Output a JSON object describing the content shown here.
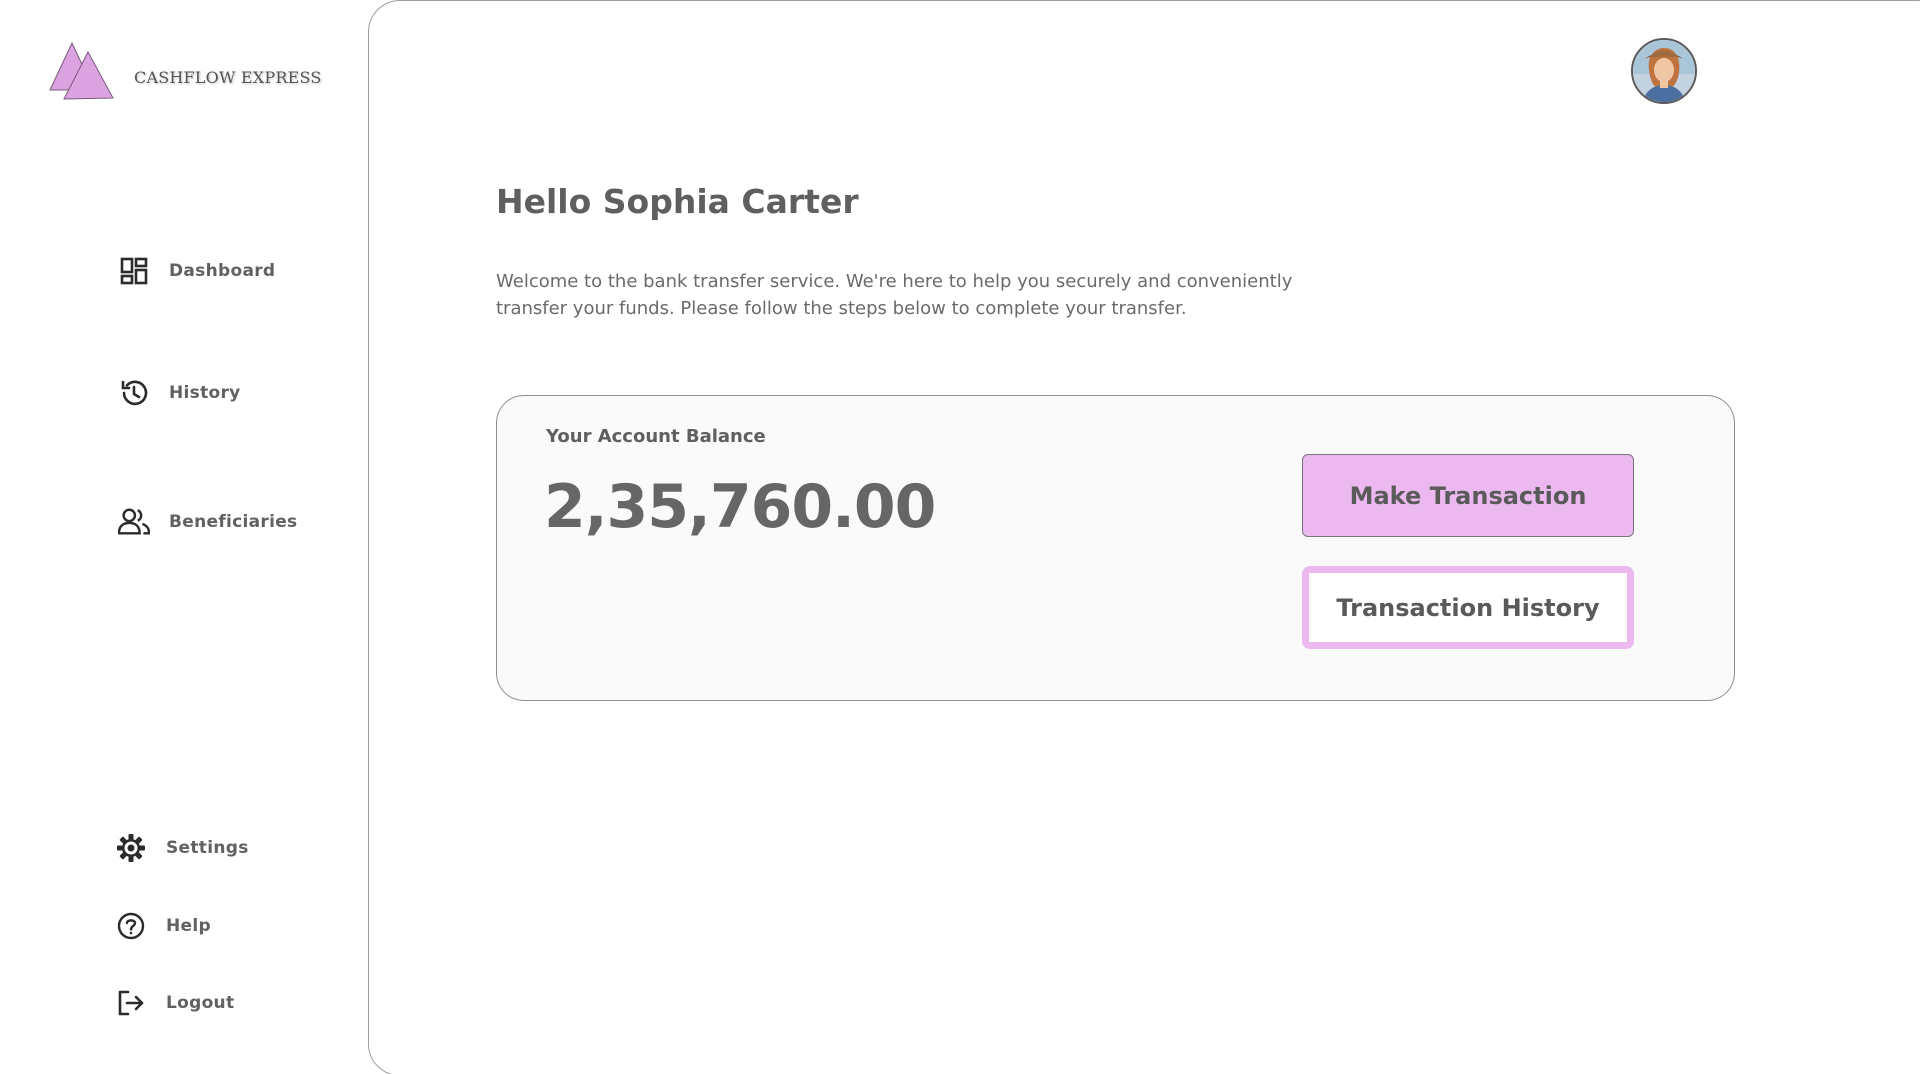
{
  "brand": {
    "name": "CASHFLOW EXPRESS",
    "logo_color": "#dba4e0"
  },
  "sidebar": {
    "nav": [
      {
        "label": "Dashboard",
        "icon": "dashboard-icon"
      },
      {
        "label": "History",
        "icon": "history-icon"
      },
      {
        "label": "Beneficiaries",
        "icon": "people-icon"
      }
    ],
    "bottom": [
      {
        "label": "Settings",
        "icon": "gear-icon"
      },
      {
        "label": "Help",
        "icon": "help-icon"
      },
      {
        "label": "Logout",
        "icon": "logout-icon"
      }
    ]
  },
  "header": {
    "avatar": "user-avatar"
  },
  "main": {
    "greeting": "Hello Sophia Carter",
    "welcome": "Welcome to the bank transfer service. We're here to help you securely and conveniently transfer your funds. Please follow the steps below to complete your transfer.",
    "balance": {
      "label": "Your Account Balance",
      "amount": "2,35,760.00"
    },
    "actions": {
      "make_transaction": "Make Transaction",
      "transaction_history": "Transaction History"
    }
  },
  "colors": {
    "accent": "#ebb8f0",
    "text": "#616161"
  }
}
